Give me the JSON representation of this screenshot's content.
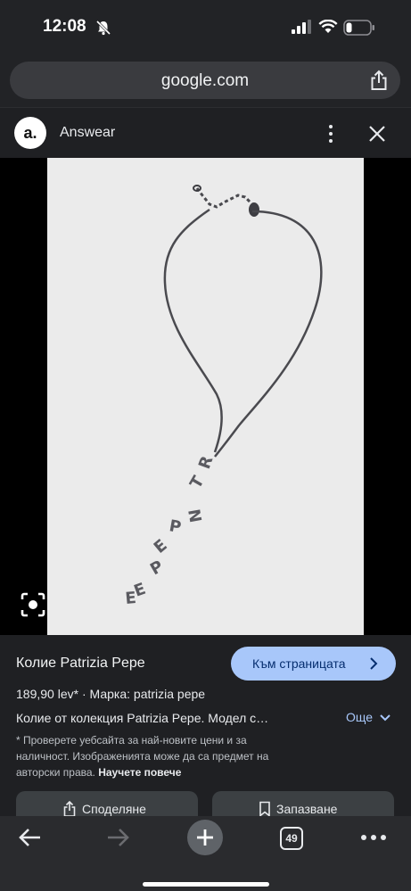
{
  "status": {
    "time": "12:08"
  },
  "browser": {
    "url": "google.com"
  },
  "lens": {
    "site_logo": "a.",
    "site_name": "Answear"
  },
  "product": {
    "title": "Колие Patrizia Pepe",
    "visit_label": "Към страницата",
    "price": "189,90 lev*",
    "brand": "Марка: patrizia pepe",
    "description": "Колие от колекция Patrizia Pepe. Модел с…",
    "more_label": "Още",
    "disclaimer": "* Проверете уебсайта за най-новите цени и за наличност. Изображенията може да са предмет на авторски права.",
    "learn_more": "Научете повече",
    "share_label": "Споделяне",
    "save_label": "Запазване"
  },
  "toolbar": {
    "tab_count": "49"
  },
  "icons": [
    "muted-bell-icon",
    "signal-icon",
    "wifi-icon",
    "battery-icon",
    "share-icon",
    "kebab-menu-icon",
    "close-icon",
    "lens-search-icon",
    "chevron-right-icon",
    "chevron-down-icon",
    "bookmark-icon",
    "back-arrow-icon",
    "forward-arrow-icon",
    "plus-icon",
    "more-icon"
  ],
  "colors": {
    "accent": "#a8c7fa",
    "background": "#1f2023"
  }
}
